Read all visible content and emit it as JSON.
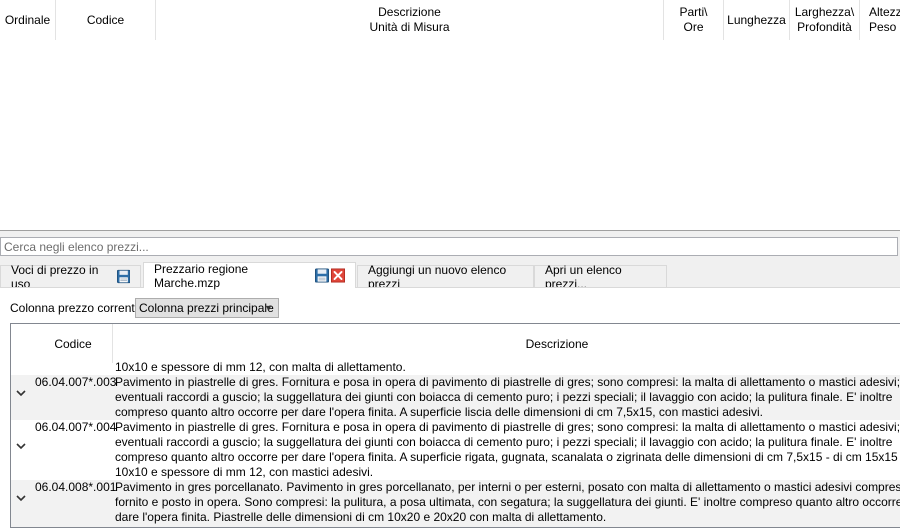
{
  "top_grid": {
    "headers": {
      "ordinale": "Ordinale",
      "codice": "Codice",
      "descrizione_1": "Descrizione",
      "descrizione_2": "Unità di Misura",
      "parti_1": "Parti\\",
      "parti_2": "Ore",
      "lunghezza": "Lunghezza",
      "larghezza_1": "Larghezza\\",
      "larghezza_2": "Profondità",
      "altezza_1": "Altezz",
      "altezza_2": "Peso"
    }
  },
  "search": {
    "placeholder": "Cerca negli elenco prezzi..."
  },
  "tabs": [
    {
      "label": "Voci di prezzo in uso"
    },
    {
      "label": "Prezzario regione Marche.mzp"
    },
    {
      "label": "Aggiungi un nuovo elenco prezzi"
    },
    {
      "label": "Apri un elenco prezzi..."
    }
  ],
  "colonna_prezzo": {
    "label": "Colonna prezzo corrente",
    "selected": "Colonna prezzi principale"
  },
  "bottom_grid": {
    "headers": {
      "codice": "Codice",
      "descrizione": "Descrizione"
    },
    "prev_tail": "10x10 e spessore di mm 12, con malta di allettamento.",
    "rows": [
      {
        "code": "06.04.007*.003",
        "lines": [
          "Pavimento in piastrelle di gres. Fornitura e posa in opera di pavimento di piastrelle di gres; sono compresi: la malta di allettamento o mastici adesivi; gli",
          "eventuali raccordi a guscio; la suggellatura dei giunti con boiacca di cemento puro; i pezzi speciali; il lavaggio con acido; la pulitura finale. E' inoltre",
          "compreso quanto altro occorre per dare l'opera finita. A superficie liscia delle dimensioni di cm 7,5x15, con mastici adesivi."
        ]
      },
      {
        "code": "06.04.007*.004",
        "lines": [
          "Pavimento in piastrelle di gres. Fornitura e posa in opera di pavimento di piastrelle di gres; sono compresi: la malta di allettamento o mastici adesivi; gli",
          "eventuali raccordi a guscio; la suggellatura dei giunti con boiacca di cemento puro; i pezzi speciali; il lavaggio con acido; la pulitura finale. E' inoltre",
          "compreso quanto altro occorre per dare l'opera finita. A superficie rigata, gugnata, scanalata o zigrinata delle dimensioni di cm 7,5x15 - di cm 15x15 o di",
          "10x10 e spessore di mm 12, con mastici adesivi."
        ]
      },
      {
        "code": "06.04.008*.001",
        "lines": [
          "Pavimento in gres porcellanato. Pavimento in gres porcellanato, per interni o per esterni, posato con malta di allettamento o mastici adesivi compresi,",
          "fornito e posto in opera. Sono compresi: la pulitura, a posa ultimata, con segatura; la suggellatura dei giunti. E' inoltre compreso quanto altro occorre per",
          "dare l'opera finita. Piastrelle delle dimensioni di cm 10x20 e 20x20 con malta di allettamento."
        ]
      }
    ]
  }
}
